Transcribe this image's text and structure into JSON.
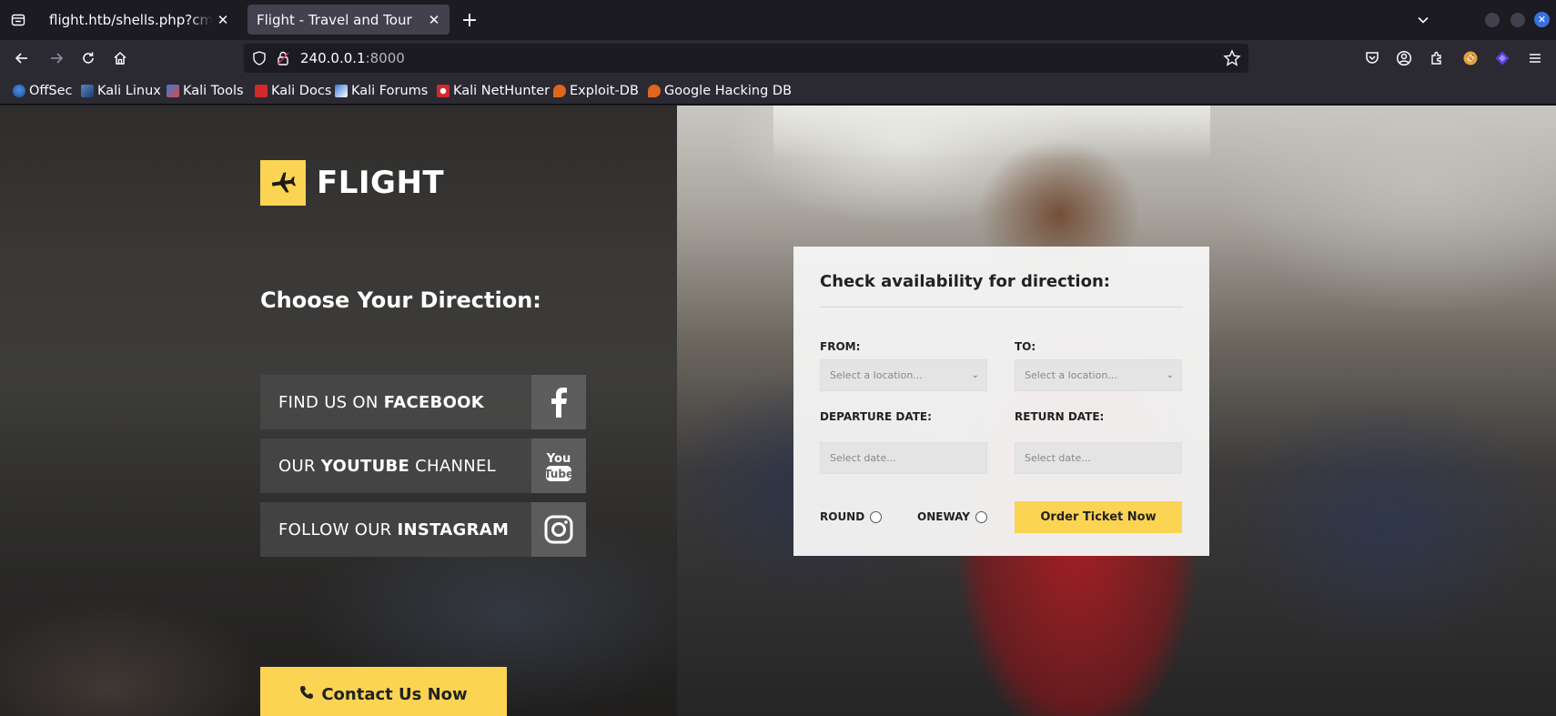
{
  "browser": {
    "tabs": [
      {
        "title": "flight.htb/shells.php?cmd=powershell",
        "active": false
      },
      {
        "title": "Flight - Travel and Tour",
        "active": true
      }
    ],
    "url_host": "240.0.0.1",
    "url_port": ":8000",
    "bookmarks": [
      {
        "label": "OffSec",
        "icon": "offsec-icon"
      },
      {
        "label": "Kali Linux",
        "icon": "kali-icon"
      },
      {
        "label": "Kali Tools",
        "icon": "kali-tools-icon"
      },
      {
        "label": "Kali Docs",
        "icon": "kali-docs-icon"
      },
      {
        "label": "Kali Forums",
        "icon": "kali-forums-icon"
      },
      {
        "label": "Kali NetHunter",
        "icon": "nethunter-icon"
      },
      {
        "label": "Exploit-DB",
        "icon": "exploitdb-icon"
      },
      {
        "label": "Google Hacking DB",
        "icon": "ghdb-icon"
      }
    ]
  },
  "site": {
    "logo_text": "FLIGHT",
    "direction_title": "Choose Your Direction:",
    "social": {
      "facebook_pre": "FIND US ON ",
      "facebook_bold": "FACEBOOK",
      "youtube_pre": "OUR ",
      "youtube_bold": "YOUTUBE",
      "youtube_post": " CHANNEL",
      "instagram_pre": "FOLLOW OUR ",
      "instagram_bold": "INSTAGRAM"
    },
    "contact_button": "Contact Us Now"
  },
  "form": {
    "title": "Check availability for direction:",
    "from_label": "FROM:",
    "to_label": "TO:",
    "from_placeholder": "Select a location...",
    "to_placeholder": "Select a location...",
    "departure_label": "DEPARTURE DATE:",
    "return_label": "RETURN DATE:",
    "departure_placeholder": "Select date...",
    "return_placeholder": "Select date...",
    "round_label": "ROUND",
    "oneway_label": "ONEWAY",
    "order_button": "Order Ticket Now"
  },
  "colors": {
    "accent_yellow": "#fbd453",
    "chrome_dark": "#1c1b22",
    "chrome_toolbar": "#2b2a33"
  }
}
